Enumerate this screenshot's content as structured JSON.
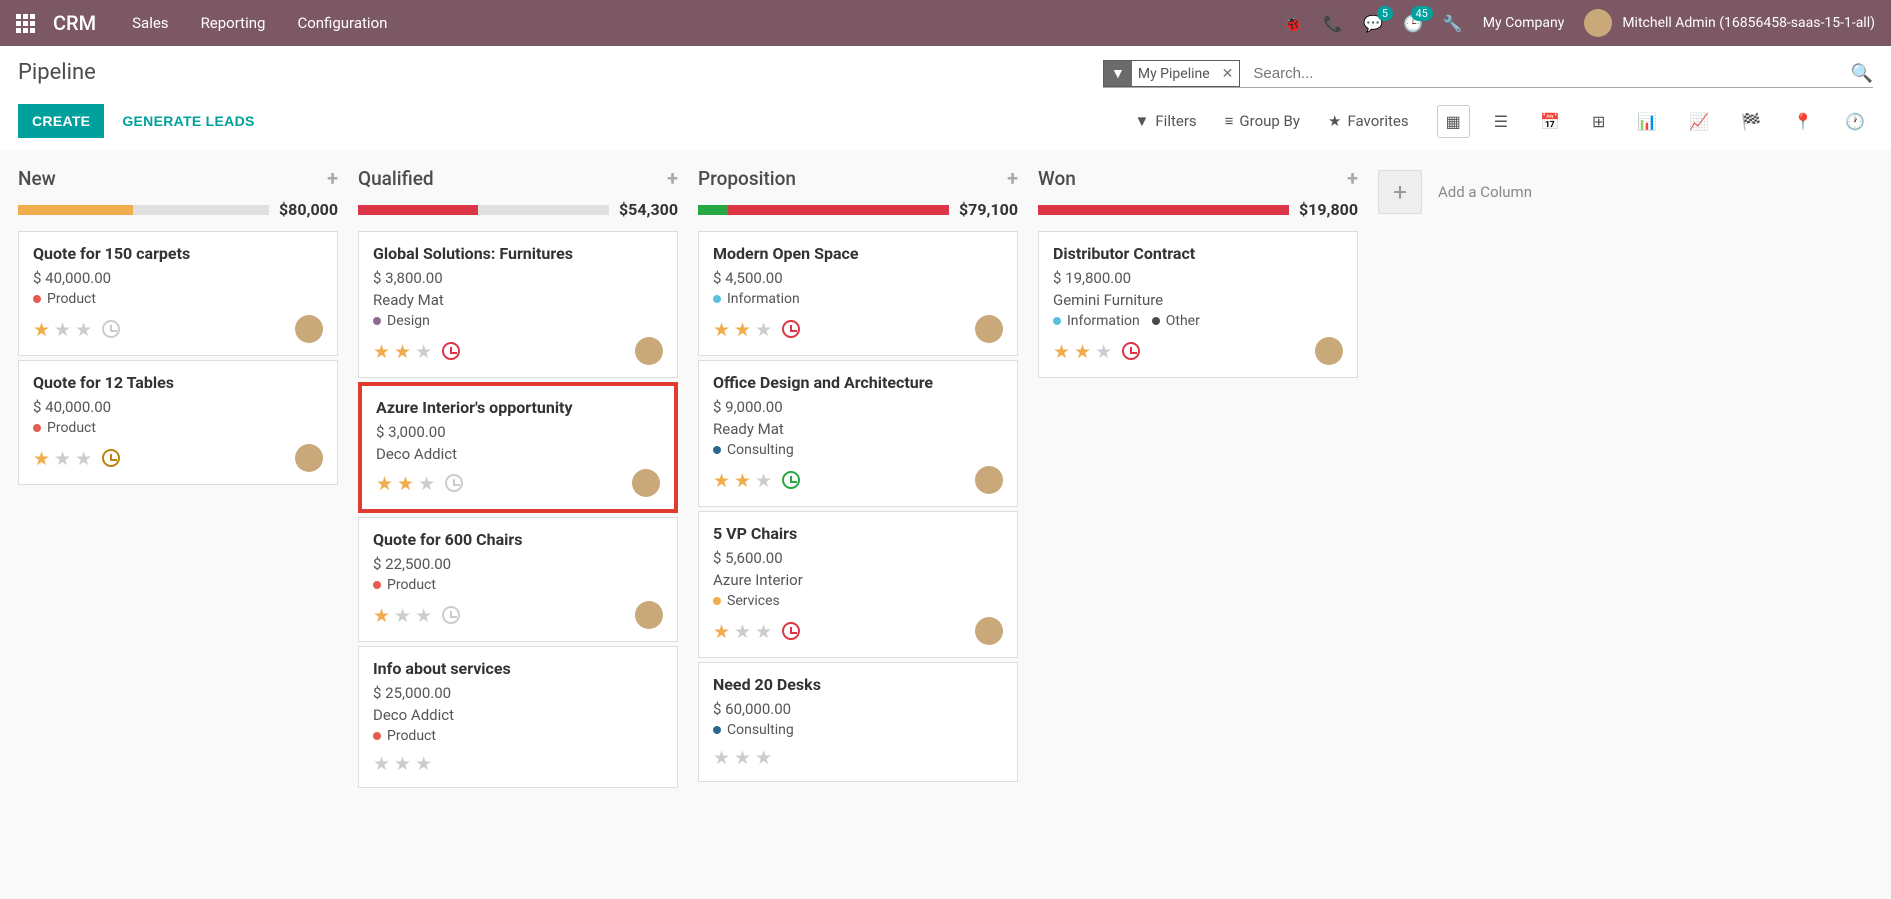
{
  "header": {
    "brand": "CRM",
    "nav": [
      "Sales",
      "Reporting",
      "Configuration"
    ],
    "msg_badge": "5",
    "activity_badge": "45",
    "company": "My Company",
    "user": "Mitchell Admin (16856458-saas-15-1-all)"
  },
  "subhead": {
    "title": "Pipeline",
    "filter_chip": "My Pipeline",
    "search_placeholder": "Search...",
    "create": "CREATE",
    "generate": "GENERATE LEADS",
    "filters": "Filters",
    "groupby": "Group By",
    "favorites": "Favorites"
  },
  "add_column": "Add a Column",
  "columns": [
    {
      "title": "New",
      "total": "$80,000",
      "bars": [
        {
          "color": "#f0ad4e",
          "width": "46%"
        }
      ],
      "cards": [
        {
          "title": "Quote for 150 carpets",
          "amount": "$ 40,000.00",
          "tags": [
            {
              "dot": "#e45b4f",
              "label": "Product"
            }
          ],
          "stars": 1,
          "clock": "gray",
          "avatar": true
        },
        {
          "title": "Quote for 12 Tables",
          "amount": "$ 40,000.00",
          "tags": [
            {
              "dot": "#e45b4f",
              "label": "Product"
            }
          ],
          "stars": 1,
          "clock": "amber",
          "avatar": true
        }
      ]
    },
    {
      "title": "Qualified",
      "total": "$54,300",
      "bars": [
        {
          "color": "#dc3545",
          "width": "48%"
        }
      ],
      "cards": [
        {
          "title": "Global Solutions: Furnitures",
          "amount": "$ 3,800.00",
          "sub": "Ready Mat",
          "tags": [
            {
              "dot": "#8e6b8e",
              "label": "Design"
            }
          ],
          "stars": 2,
          "clock": "red",
          "avatar": true
        },
        {
          "title": "Azure Interior's opportunity",
          "amount": "$ 3,000.00",
          "sub": "Deco Addict",
          "stars": 2,
          "clock": "gray",
          "avatar": true,
          "highlighted": true
        },
        {
          "title": "Quote for 600 Chairs",
          "amount": "$ 22,500.00",
          "tags": [
            {
              "dot": "#e45b4f",
              "label": "Product"
            }
          ],
          "stars": 1,
          "clock": "gray",
          "avatar": true
        },
        {
          "title": "Info about services",
          "amount": "$ 25,000.00",
          "sub": "Deco Addict",
          "tags": [
            {
              "dot": "#e45b4f",
              "label": "Product"
            }
          ],
          "stars": 0
        }
      ]
    },
    {
      "title": "Proposition",
      "total": "$79,100",
      "bars": [
        {
          "color": "#28a745",
          "width": "12%"
        },
        {
          "color": "#dc3545",
          "width": "88%"
        }
      ],
      "cards": [
        {
          "title": "Modern Open Space",
          "amount": "$ 4,500.00",
          "tags": [
            {
              "dot": "#5bc0de",
              "label": "Information"
            }
          ],
          "stars": 2,
          "clock": "red",
          "avatar": true
        },
        {
          "title": "Office Design and Architecture",
          "amount": "$ 9,000.00",
          "sub": "Ready Mat",
          "tags": [
            {
              "dot": "#2b6a8e",
              "label": "Consulting"
            }
          ],
          "stars": 2,
          "clock": "green",
          "avatar": true
        },
        {
          "title": "5 VP Chairs",
          "amount": "$ 5,600.00",
          "sub": "Azure Interior",
          "tags": [
            {
              "dot": "#f0ad4e",
              "label": "Services"
            }
          ],
          "stars": 1,
          "clock": "red",
          "avatar": true
        },
        {
          "title": "Need 20 Desks",
          "amount": "$ 60,000.00",
          "tags": [
            {
              "dot": "#2b6a8e",
              "label": "Consulting"
            }
          ],
          "stars": 0
        }
      ]
    },
    {
      "title": "Won",
      "total": "$19,800",
      "bars": [
        {
          "color": "#dc3545",
          "width": "100%"
        }
      ],
      "cards": [
        {
          "title": "Distributor Contract",
          "amount": "$ 19,800.00",
          "sub": "Gemini Furniture",
          "tags": [
            {
              "dot": "#5bc0de",
              "label": "Information"
            },
            {
              "dot": "#4a4a4a",
              "label": "Other"
            }
          ],
          "stars": 2,
          "clock": "red",
          "avatar": true
        }
      ]
    }
  ]
}
